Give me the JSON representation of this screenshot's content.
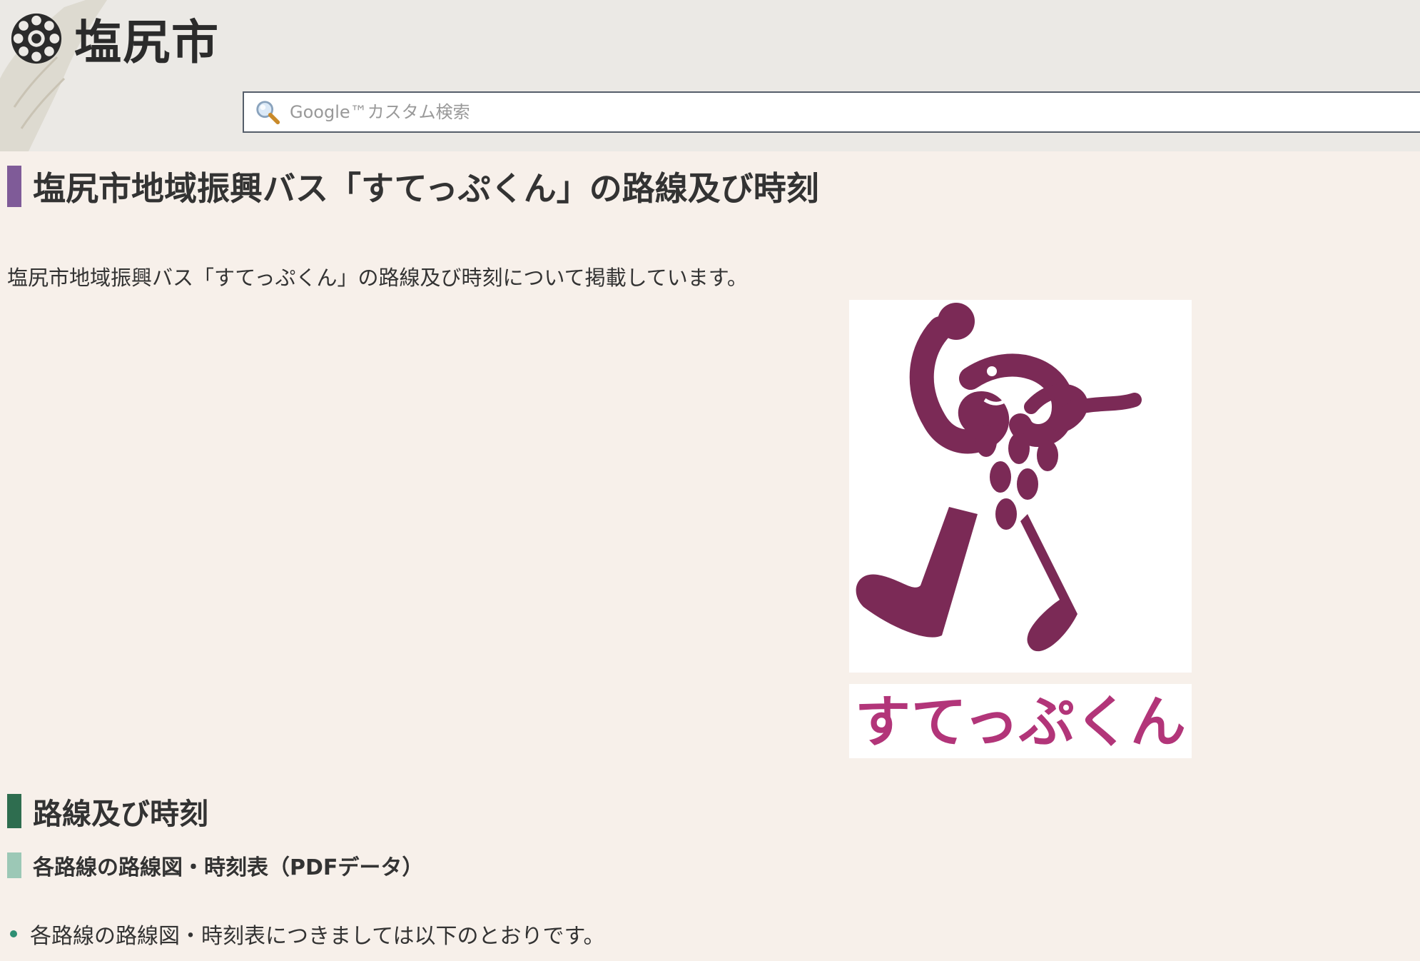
{
  "header": {
    "logo_text": "塩尻市",
    "search_placeholder": "Google™カスタム検索"
  },
  "main": {
    "page_title": "塩尻市地域振興バス「すてっぷくん」の路線及び時刻",
    "intro": "塩尻市地域振興バス「すてっぷくん」の路線及び時刻について掲載しています。",
    "mascot": {
      "name_text": "すてっぷくん",
      "colors": {
        "body": "#7b2a56",
        "name": "#b23579"
      }
    },
    "section_heading": "路線及び時刻",
    "subsection_heading": "各路線の路線図・時刻表（PDFデータ）",
    "list_items": [
      "各路線の路線図・時刻表につきましては以下のとおりです。"
    ]
  },
  "colors": {
    "page_bg": "#f7f0ea",
    "header_bg": "#ebe9e5",
    "title_bar": "#7f5b98",
    "section_bar": "#2e6d4f",
    "subsection_bar": "#9cc8b6",
    "bullet": "#2e8f73"
  }
}
